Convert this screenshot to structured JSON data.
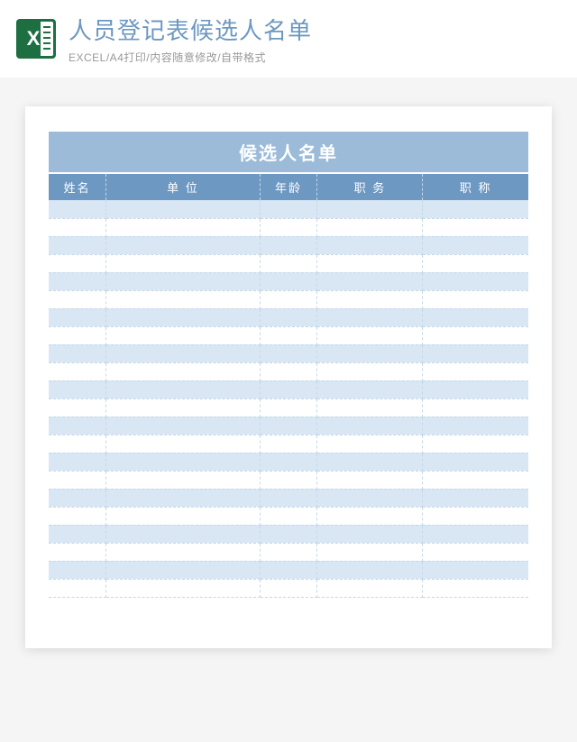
{
  "header": {
    "title": "人员登记表候选人名单",
    "subtitle": "EXCEL/A4打印/内容随意修改/自带格式",
    "icon_glyph": "X"
  },
  "sheet": {
    "table_title": "候选人名单",
    "columns": [
      "姓名",
      "单 位",
      "年龄",
      "职 务",
      "职 称"
    ],
    "row_count": 22
  }
}
